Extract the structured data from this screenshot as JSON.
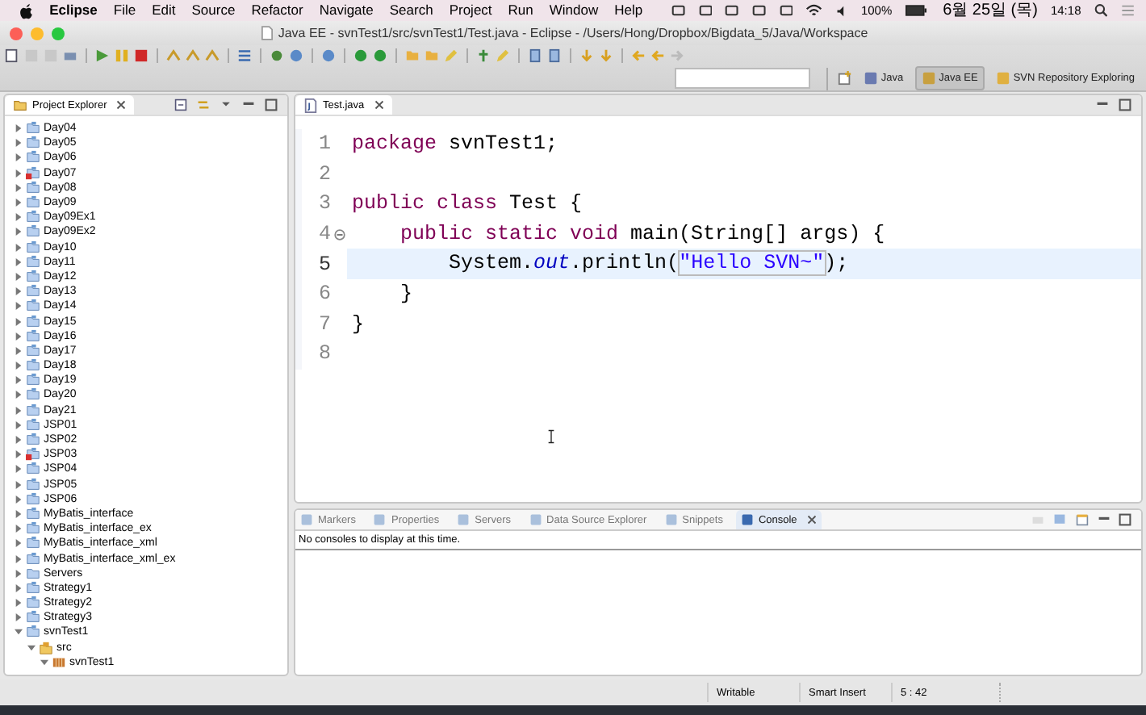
{
  "menu_bar": {
    "app": "Eclipse",
    "menus": [
      "File",
      "Edit",
      "Source",
      "Refactor",
      "Navigate",
      "Search",
      "Project",
      "Run",
      "Window",
      "Help"
    ],
    "battery": "100%",
    "date": "6월 25일 (목)",
    "time": "14:18"
  },
  "window": {
    "title": "Java EE - svnTest1/src/svnTest1/Test.java - Eclipse - /Users/Hong/Dropbox/Bigdata_5/Java/Workspace"
  },
  "perspectives": [
    {
      "label": "Java",
      "selected": false
    },
    {
      "label": "Java EE",
      "selected": true
    },
    {
      "label": "SVN Repository Exploring",
      "selected": false
    }
  ],
  "project_explorer": {
    "title": "Project Explorer",
    "items": [
      {
        "label": "Day04",
        "kind": "project",
        "expanded": false,
        "error": false
      },
      {
        "label": "Day05",
        "kind": "project",
        "expanded": false,
        "error": false
      },
      {
        "label": "Day06",
        "kind": "project",
        "expanded": false,
        "error": false
      },
      {
        "label": "Day07",
        "kind": "project",
        "expanded": false,
        "error": true
      },
      {
        "label": "Day08",
        "kind": "project",
        "expanded": false,
        "error": false
      },
      {
        "label": "Day09",
        "kind": "project",
        "expanded": false,
        "error": false
      },
      {
        "label": "Day09Ex1",
        "kind": "project",
        "expanded": false,
        "error": false
      },
      {
        "label": "Day09Ex2",
        "kind": "project",
        "expanded": false,
        "error": false
      },
      {
        "label": "Day10",
        "kind": "project",
        "expanded": false,
        "error": false
      },
      {
        "label": "Day11",
        "kind": "project",
        "expanded": false,
        "error": false
      },
      {
        "label": "Day12",
        "kind": "project",
        "expanded": false,
        "error": false
      },
      {
        "label": "Day13",
        "kind": "project",
        "expanded": false,
        "error": false
      },
      {
        "label": "Day14",
        "kind": "project",
        "expanded": false,
        "error": false
      },
      {
        "label": "Day15",
        "kind": "project",
        "expanded": false,
        "error": false
      },
      {
        "label": "Day16",
        "kind": "project",
        "expanded": false,
        "error": false
      },
      {
        "label": "Day17",
        "kind": "project",
        "expanded": false,
        "error": false
      },
      {
        "label": "Day18",
        "kind": "project",
        "expanded": false,
        "error": false
      },
      {
        "label": "Day19",
        "kind": "project",
        "expanded": false,
        "error": false
      },
      {
        "label": "Day20",
        "kind": "project",
        "expanded": false,
        "error": false
      },
      {
        "label": "Day21",
        "kind": "project",
        "expanded": false,
        "error": false
      },
      {
        "label": "JSP01",
        "kind": "project",
        "expanded": false,
        "error": false
      },
      {
        "label": "JSP02",
        "kind": "project",
        "expanded": false,
        "error": false
      },
      {
        "label": "JSP03",
        "kind": "project",
        "expanded": false,
        "error": true
      },
      {
        "label": "JSP04",
        "kind": "project",
        "expanded": false,
        "error": false
      },
      {
        "label": "JSP05",
        "kind": "project",
        "expanded": false,
        "error": false
      },
      {
        "label": "JSP06",
        "kind": "project",
        "expanded": false,
        "error": false
      },
      {
        "label": "MyBatis_interface",
        "kind": "project",
        "expanded": false,
        "error": false
      },
      {
        "label": "MyBatis_interface_ex",
        "kind": "project",
        "expanded": false,
        "error": false
      },
      {
        "label": "MyBatis_interface_xml",
        "kind": "project",
        "expanded": false,
        "error": false
      },
      {
        "label": "MyBatis_interface_xml_ex",
        "kind": "project",
        "expanded": false,
        "error": false
      },
      {
        "label": "Servers",
        "kind": "folder",
        "expanded": false,
        "error": false
      },
      {
        "label": "Strategy1",
        "kind": "project",
        "expanded": false,
        "error": false
      },
      {
        "label": "Strategy2",
        "kind": "project",
        "expanded": false,
        "error": false
      },
      {
        "label": "Strategy3",
        "kind": "project",
        "expanded": false,
        "error": false
      },
      {
        "label": "svnTest1",
        "kind": "project",
        "expanded": true,
        "error": false,
        "children": [
          {
            "label": "src",
            "kind": "source",
            "expanded": true,
            "error": false,
            "children": [
              {
                "label": "svnTest1",
                "kind": "package",
                "expanded": true,
                "error": false
              }
            ]
          }
        ]
      }
    ]
  },
  "editor": {
    "tab": "Test.java",
    "lines": [
      {
        "number": "1",
        "current": false,
        "foldable": false,
        "tokens": [
          {
            "kind": "keyword",
            "text": "package"
          },
          {
            "kind": "plain",
            "text": " svnTest1;"
          }
        ]
      },
      {
        "number": "2",
        "current": false,
        "foldable": false
      },
      {
        "number": "3",
        "current": false,
        "foldable": false,
        "tokens": [
          {
            "kind": "keyword",
            "text": "public "
          },
          {
            "kind": "keyword",
            "text": "class"
          },
          {
            "kind": "plain",
            "text": " Test {"
          }
        ]
      },
      {
        "number": "4",
        "current": false,
        "foldable": true,
        "tokens": [
          {
            "kind": "keyword",
            "text": "    public "
          },
          {
            "kind": "keyword",
            "text": "static "
          },
          {
            "kind": "keyword",
            "text": "void"
          },
          {
            "kind": "plain",
            "text": " main(String[] args) {"
          }
        ]
      },
      {
        "number": "5",
        "current": true,
        "foldable": false,
        "tokens": [
          {
            "kind": "plain",
            "text": "        System."
          },
          {
            "kind": "field",
            "text": "out"
          },
          {
            "kind": "plain",
            "text": ".println("
          },
          {
            "kind": "string",
            "text": "\"Hello SVN~\""
          },
          {
            "kind": "plain",
            "text": ");"
          }
        ]
      },
      {
        "number": "6",
        "current": false,
        "foldable": false,
        "tokens": [
          {
            "kind": "plain",
            "text": "    }"
          }
        ]
      },
      {
        "number": "7",
        "current": false,
        "foldable": false,
        "tokens": [
          {
            "kind": "plain",
            "text": "}"
          }
        ]
      },
      {
        "number": "8",
        "current": false,
        "foldable": false
      }
    ]
  },
  "bottom_panel": {
    "tabs": [
      {
        "label": "Markers",
        "selected": false
      },
      {
        "label": "Properties",
        "selected": false
      },
      {
        "label": "Servers",
        "selected": false
      },
      {
        "label": "Data Source Explorer",
        "selected": false
      },
      {
        "label": "Snippets",
        "selected": false
      },
      {
        "label": "Console",
        "selected": true
      }
    ],
    "message": "No consoles to display at this time."
  },
  "status_bar": [
    "Writable",
    "Smart Insert",
    "5 : 42"
  ]
}
